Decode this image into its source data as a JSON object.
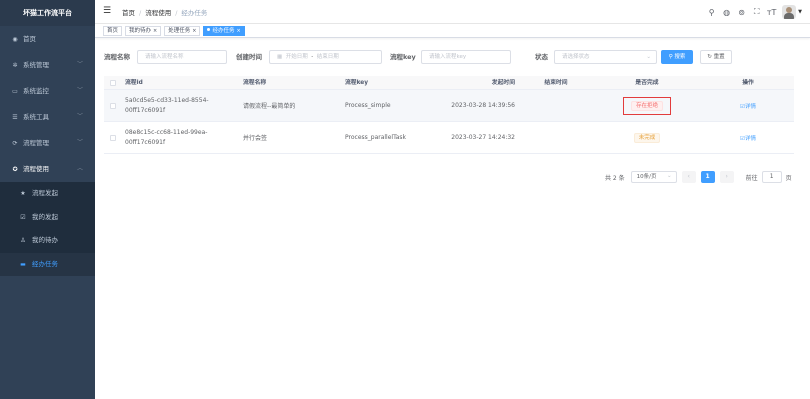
{
  "sidebar": {
    "title": "坏猫工作流平台",
    "menu": [
      {
        "label": "首页",
        "icon": "dashboard-icon"
      },
      {
        "label": "系统管理",
        "icon": "gear-icon"
      },
      {
        "label": "系统监控",
        "icon": "monitor-icon"
      },
      {
        "label": "系统工具",
        "icon": "tool-icon"
      },
      {
        "label": "流程管理",
        "icon": "flow-icon"
      },
      {
        "label": "流程使用",
        "icon": "flow-use-icon"
      }
    ],
    "submenu": [
      {
        "label": "流程发起",
        "icon": "star-icon"
      },
      {
        "label": "我的发起",
        "icon": "edit-icon"
      },
      {
        "label": "我的待办",
        "icon": "user-icon"
      },
      {
        "label": "经办任务",
        "icon": "list-icon"
      }
    ]
  },
  "breadcrumb": [
    "首页",
    "流程使用",
    "经办任务"
  ],
  "tags": [
    {
      "label": "首页"
    },
    {
      "label": "我的待办"
    },
    {
      "label": "处理任务"
    },
    {
      "label": "经办任务"
    }
  ],
  "search": {
    "name_label": "流程名称",
    "name_placeholder": "请输入流程名称",
    "time_label": "创建时间",
    "start_placeholder": "开始日期",
    "range_sep": "-",
    "end_placeholder": "结束日期",
    "key_label": "流程key",
    "key_placeholder": "请输入流程key",
    "status_label": "状态",
    "status_placeholder": "请选择状态",
    "search_btn": "搜索",
    "reset_btn": "重置"
  },
  "table": {
    "headers": [
      "流程id",
      "流程名称",
      "流程key",
      "发起时间",
      "结束时间",
      "是否完成",
      "操作"
    ],
    "rows": [
      {
        "id": "5a0cd5e5-cd33-11ed-8554-00ff17c6091f",
        "name": "请假流程--最简单的",
        "key": "Process_simple",
        "start": "2023-03-28 14:39:56",
        "end": "",
        "status": "存在拒绝",
        "action": "详情"
      },
      {
        "id": "08e8c15c-cc68-11ed-99ea-00ff17c6091f",
        "name": "并行会签",
        "key": "Process_parallelTask",
        "start": "2023-03-27 14:24:32",
        "end": "",
        "status": "未完成",
        "action": "详情"
      }
    ]
  },
  "pagination": {
    "total": "共 2 条",
    "page_size": "10条/页",
    "current": "1",
    "goto_label": "前往",
    "goto_value": "1",
    "page_unit": "页"
  },
  "colors": {
    "primary": "#409eff",
    "sidebar": "#304156",
    "danger": "#f56c6c",
    "warning": "#e6a23c"
  }
}
